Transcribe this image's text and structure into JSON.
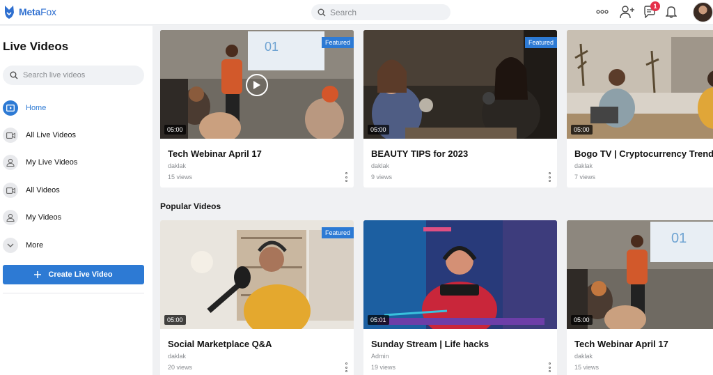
{
  "app": {
    "brand_meta": "Meta",
    "brand_fox": "Fox"
  },
  "header": {
    "search_placeholder": "Search",
    "notification_count": "1"
  },
  "sidebar": {
    "title": "Live Videos",
    "search_placeholder": "Search live videos",
    "items": [
      {
        "label": "Home",
        "icon": "live-screen-icon",
        "active": true
      },
      {
        "label": "All Live Videos",
        "icon": "video-camera-icon"
      },
      {
        "label": "My Live Videos",
        "icon": "user-icon"
      },
      {
        "label": "All Videos",
        "icon": "video-camera-icon"
      },
      {
        "label": "My Videos",
        "icon": "user-icon"
      },
      {
        "label": "More",
        "icon": "chevron-down-icon"
      }
    ],
    "create_button": "Create Live Video"
  },
  "main": {
    "top_row": [
      {
        "title": "Tech Webinar April 17",
        "author": "daklak",
        "views": "15 views",
        "duration": "05:00",
        "featured": "Featured",
        "playing": true
      },
      {
        "title": "BEAUTY TIPS for 2023",
        "author": "daklak",
        "views": "9 views",
        "duration": "05:00",
        "featured": "Featured"
      },
      {
        "title": "Bogo TV | Cryptocurrency Trends",
        "author": "daklak",
        "views": "7 views",
        "duration": "05:00"
      }
    ],
    "popular_title": "Popular Videos",
    "popular": [
      {
        "title": "Social Marketplace Q&A",
        "author": "daklak",
        "views": "20 views",
        "duration": "05:00",
        "featured": "Featured"
      },
      {
        "title": "Sunday Stream | Life hacks",
        "author": "Admin",
        "views": "19 views",
        "duration": "05:01"
      },
      {
        "title": "Tech Webinar April 17",
        "author": "daklak",
        "views": "15 views",
        "duration": "05:00"
      }
    ]
  },
  "colors": {
    "accent": "#2d7ad4",
    "badge": "#e5304a",
    "page_bg": "#f0f1f3"
  }
}
